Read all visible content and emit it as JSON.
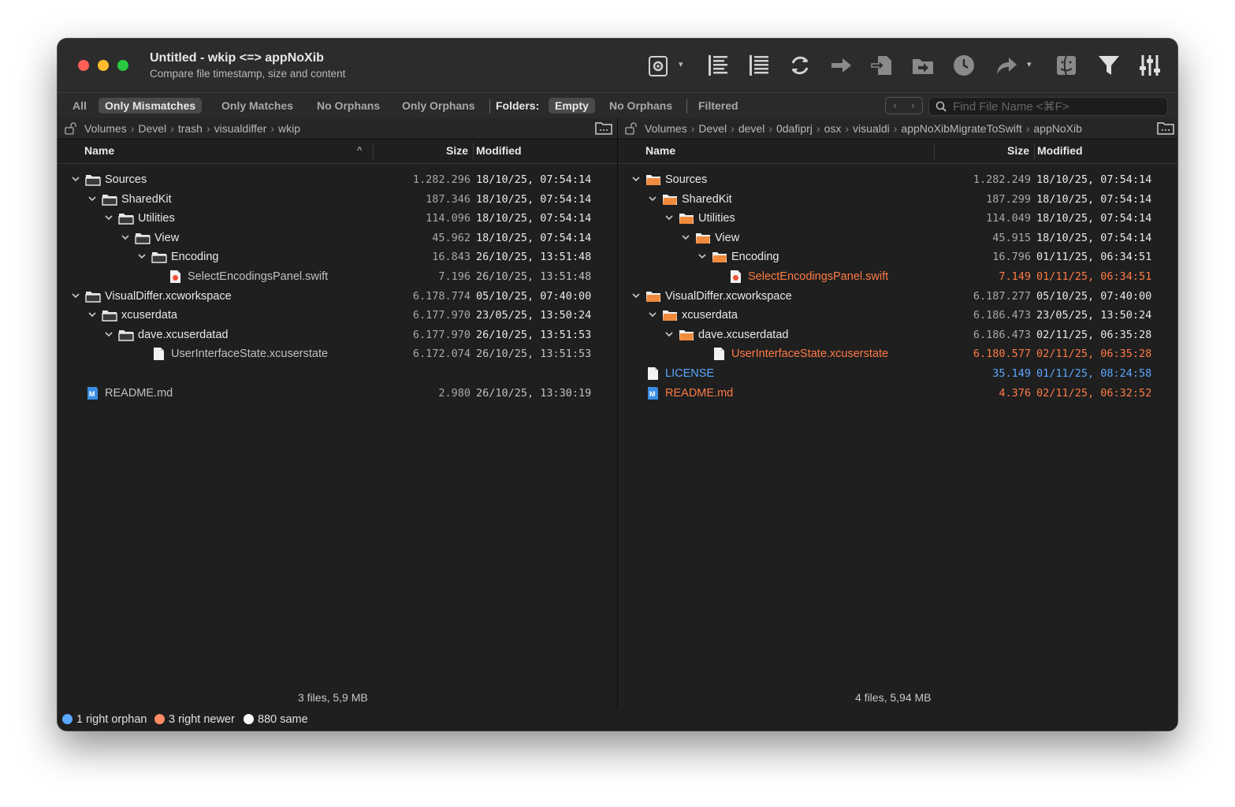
{
  "window": {
    "title": "Untitled - wkip <=> appNoXib",
    "subtitle": "Compare file timestamp, size and content"
  },
  "toolbar": {
    "icons": [
      "settings-gear-icon",
      "align-left-icon",
      "align-right-icon",
      "refresh-icon",
      "arrow-right-icon",
      "copy-to-icon",
      "move-folder-icon",
      "clock-icon",
      "share-arrow-icon",
      "finder-icon",
      "filter-funnel-icon",
      "sliders-icon"
    ]
  },
  "filters": {
    "all": "All",
    "only_mismatches": "Only Mismatches",
    "only_matches": "Only Matches",
    "no_orphans": "No Orphans",
    "only_orphans": "Only Orphans",
    "folders_label": "Folders:",
    "empty": "Empty",
    "folders_no_orphans": "No Orphans",
    "filtered": "Filtered",
    "active": "Only Mismatches"
  },
  "search": {
    "placeholder": "Find File Name <⌘F>"
  },
  "left": {
    "path": [
      "Volumes",
      "Devel",
      "trash",
      "visualdiffer",
      "wkip"
    ],
    "headers": {
      "name": "Name",
      "size": "Size",
      "modified": "Modified"
    },
    "rows": [
      {
        "name": "Sources",
        "size": "1.282.296",
        "modified": "18/10/25, 07:54:14"
      },
      {
        "name": "SharedKit",
        "size": "187.346",
        "modified": "18/10/25, 07:54:14"
      },
      {
        "name": "Utilities",
        "size": "114.096",
        "modified": "18/10/25, 07:54:14"
      },
      {
        "name": "View",
        "size": "45.962",
        "modified": "18/10/25, 07:54:14"
      },
      {
        "name": "Encoding",
        "size": "16.843",
        "modified": "26/10/25, 13:51:48"
      },
      {
        "name": "SelectEncodingsPanel.swift",
        "size": "7.196",
        "modified": "26/10/25, 13:51:48"
      },
      {
        "name": "VisualDiffer.xcworkspace",
        "size": "6.178.774",
        "modified": "05/10/25, 07:40:00"
      },
      {
        "name": "xcuserdata",
        "size": "6.177.970",
        "modified": "23/05/25, 13:50:24"
      },
      {
        "name": "dave.xcuserdatad",
        "size": "6.177.970",
        "modified": "26/10/25, 13:51:53"
      },
      {
        "name": "UserInterfaceState.xcuserstate",
        "size": "6.172.074",
        "modified": "26/10/25, 13:51:53"
      },
      {
        "name": "",
        "size": "",
        "modified": ""
      },
      {
        "name": "README.md",
        "size": "2.980",
        "modified": "26/10/25, 13:30:19"
      }
    ],
    "summary": "3 files, 5,9 MB"
  },
  "right": {
    "path": [
      "Volumes",
      "Devel",
      "devel",
      "0dafiprj",
      "osx",
      "visualdi",
      "appNoXibMigrateToSwift",
      "appNoXib"
    ],
    "headers": {
      "name": "Name",
      "size": "Size",
      "modified": "Modified"
    },
    "rows": [
      {
        "name": "Sources",
        "size": "1.282.249",
        "modified": "18/10/25, 07:54:14"
      },
      {
        "name": "SharedKit",
        "size": "187.299",
        "modified": "18/10/25, 07:54:14"
      },
      {
        "name": "Utilities",
        "size": "114.049",
        "modified": "18/10/25, 07:54:14"
      },
      {
        "name": "View",
        "size": "45.915",
        "modified": "18/10/25, 07:54:14"
      },
      {
        "name": "Encoding",
        "size": "16.796",
        "modified": "01/11/25, 06:34:51"
      },
      {
        "name": "SelectEncodingsPanel.swift",
        "size": "7.149",
        "modified": "01/11/25, 06:34:51"
      },
      {
        "name": "VisualDiffer.xcworkspace",
        "size": "6.187.277",
        "modified": "05/10/25, 07:40:00"
      },
      {
        "name": "xcuserdata",
        "size": "6.186.473",
        "modified": "23/05/25, 13:50:24"
      },
      {
        "name": "dave.xcuserdatad",
        "size": "6.186.473",
        "modified": "02/11/25, 06:35:28"
      },
      {
        "name": "UserInterfaceState.xcuserstate",
        "size": "6.180.577",
        "modified": "02/11/25, 06:35:28"
      },
      {
        "name": "LICENSE",
        "size": "35.149",
        "modified": "01/11/25, 08:24:58"
      },
      {
        "name": "README.md",
        "size": "4.376",
        "modified": "02/11/25, 06:32:52"
      }
    ],
    "summary": "4 files, 5,94 MB"
  },
  "status": {
    "orphan": "1 right orphan",
    "newer": "3 right newer",
    "same": "880 same",
    "colors": {
      "orphan": "#5aa8ff",
      "newer": "#ff8a65",
      "same": "#ffffff"
    }
  }
}
